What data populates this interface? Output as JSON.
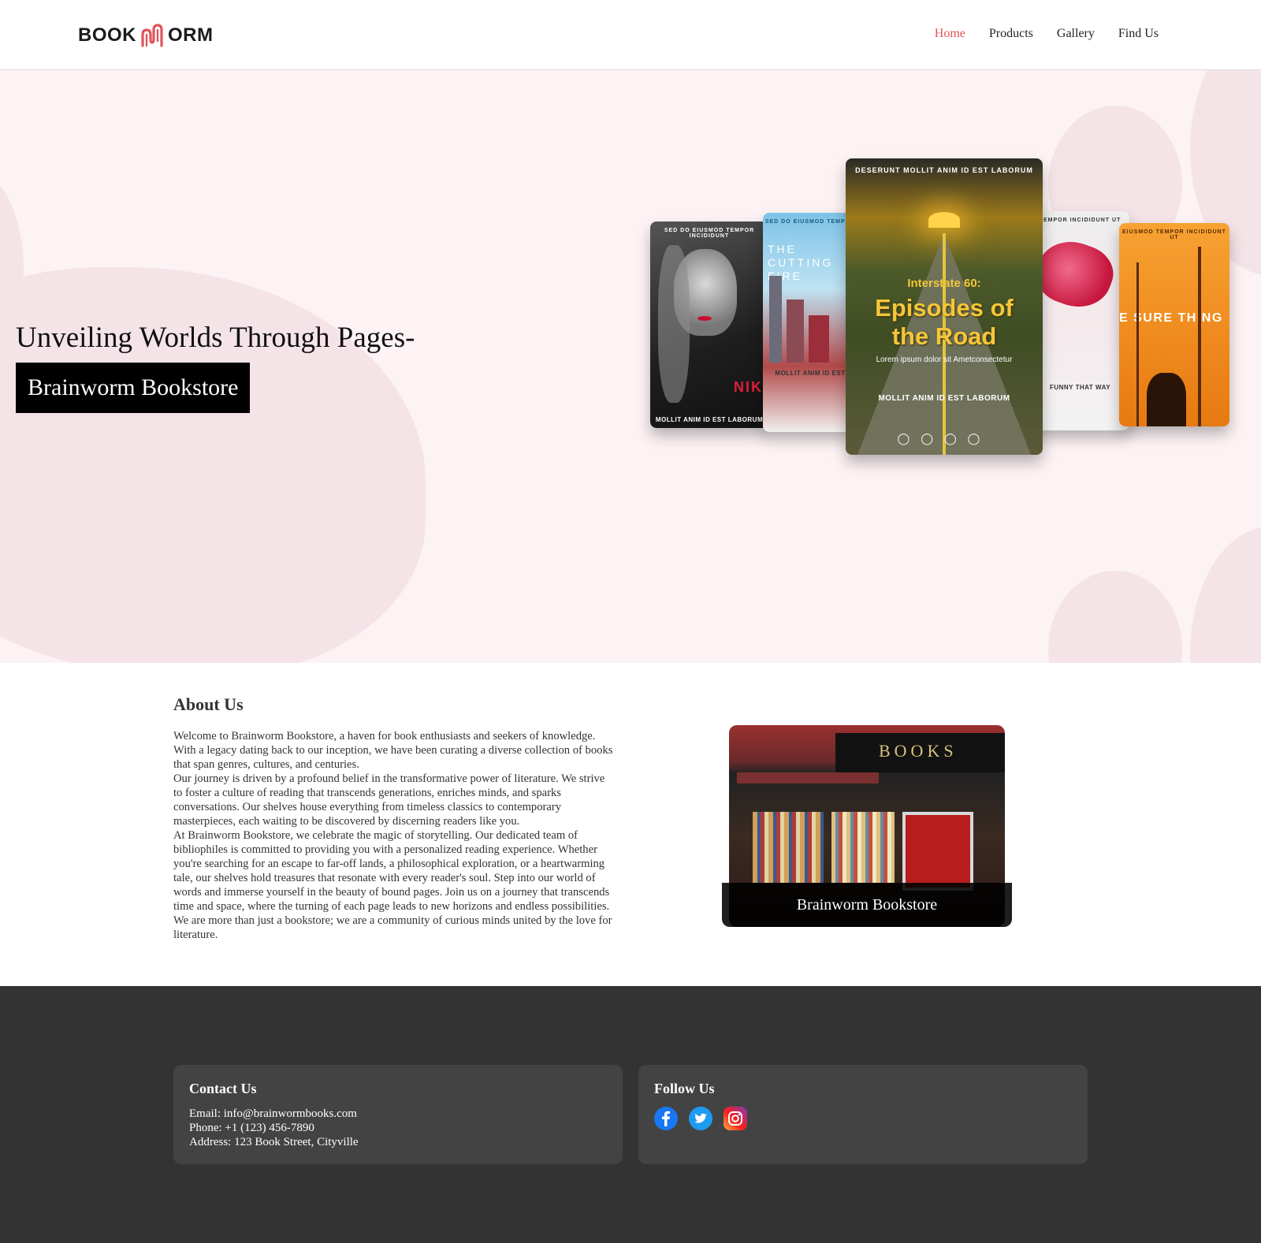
{
  "header": {
    "logo_left": "BOOK",
    "logo_right": "ORM",
    "nav": [
      {
        "label": "Home",
        "active": true
      },
      {
        "label": "Products",
        "active": false
      },
      {
        "label": "Gallery",
        "active": false
      },
      {
        "label": "Find Us",
        "active": false
      }
    ],
    "accent_color": "#e0545b"
  },
  "hero": {
    "title": "Unveiling Worlds Through Pages-",
    "badge": "Brainworm Bookstore",
    "covers": [
      {
        "top": "SED DO EIUSMOD TEMPOR INCIDIDUNT",
        "middle": "NIKI",
        "bottom": "MOLLIT ANIM ID EST LABORUM"
      },
      {
        "top": "SED DO EIUSMOD TEMPOR",
        "middle": "THE CUTTING FIRE",
        "bottom": "MOLLIT ANIM ID EST"
      },
      {
        "top": "DESERUNT MOLLIT ANIM ID EST LABORUM",
        "subtitle": "Interstate 60:",
        "title": "Episodes of the Road",
        "tagline": "Lorem ipsum dolor sit Ametconsectetur",
        "bottom": "MOLLIT ANIM ID EST LABORUM"
      },
      {
        "top": "TEMPOR INCIDIDUNT UT",
        "bottom": "FUNNY THAT WAY"
      },
      {
        "top": "EIUSMOD TEMPOR INCIDIDUNT UT",
        "middle": "E SURE THING"
      }
    ]
  },
  "about": {
    "heading": "About Us",
    "paragraphs": [
      "Welcome to Brainworm Bookstore, a haven for book enthusiasts and seekers of knowledge. With a legacy dating back to our inception, we have been curating a diverse collection of books that span genres, cultures, and centuries.",
      "Our journey is driven by a profound belief in the transformative power of literature. We strive to foster a culture of reading that transcends generations, enriches minds, and sparks conversations. Our shelves house everything from timeless classics to contemporary masterpieces, each waiting to be discovered by discerning readers like you.",
      "At Brainworm Bookstore, we celebrate the magic of storytelling. Our dedicated team of bibliophiles is committed to providing you with a personalized reading experience. Whether you're searching for an escape to far-off lands, a philosophical exploration, or a heartwarming tale, our shelves hold treasures that resonate with every reader's soul. Step into our world of words and immerse yourself in the beauty of bound pages. Join us on a journey that transcends time and space, where the turning of each page leads to new horizons and endless possibilities. We are more than just a bookstore; we are a community of curious minds united by the love for literature."
    ],
    "photo_sign": "BOOKS",
    "photo_caption": "Brainworm Bookstore"
  },
  "footer": {
    "contact": {
      "heading": "Contact Us",
      "email": "Email: info@brainwormbooks.com",
      "phone": "Phone: +1 (123) 456-7890",
      "address": "Address: 123 Book Street, Cityville"
    },
    "follow": {
      "heading": "Follow Us",
      "icons": [
        "facebook-icon",
        "twitter-icon",
        "instagram-icon"
      ]
    }
  }
}
